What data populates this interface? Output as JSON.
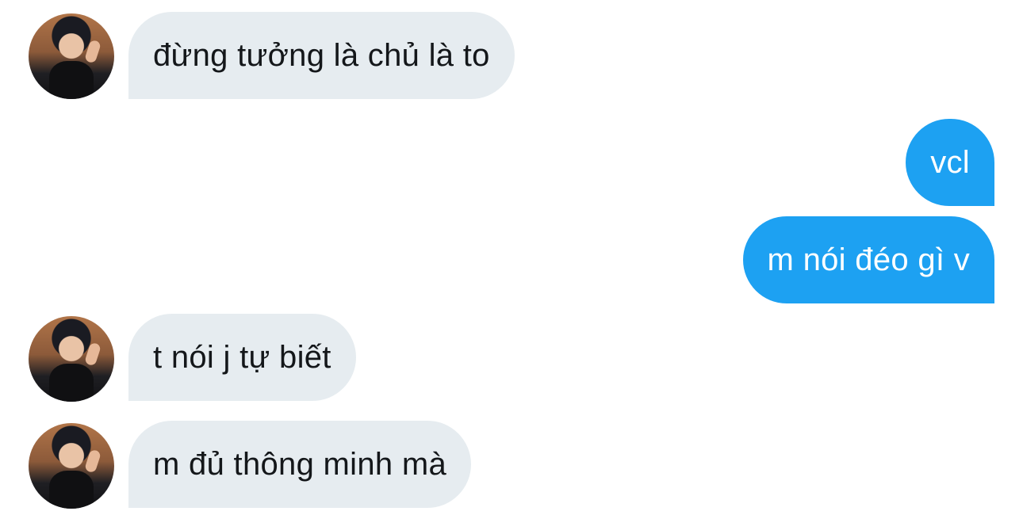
{
  "messages": [
    {
      "direction": "incoming",
      "text": "đừng tưởng là chủ là to"
    },
    {
      "direction": "outgoing",
      "text": "vcl"
    },
    {
      "direction": "outgoing",
      "text": "m nói đéo gì v"
    },
    {
      "direction": "incoming",
      "text": "t nói j tự biết"
    },
    {
      "direction": "incoming",
      "text": "m đủ thông minh mà"
    }
  ],
  "colors": {
    "incoming_bubble": "#e6ecf0",
    "outgoing_bubble": "#1da1f2",
    "incoming_text": "#14171a",
    "outgoing_text": "#ffffff"
  }
}
